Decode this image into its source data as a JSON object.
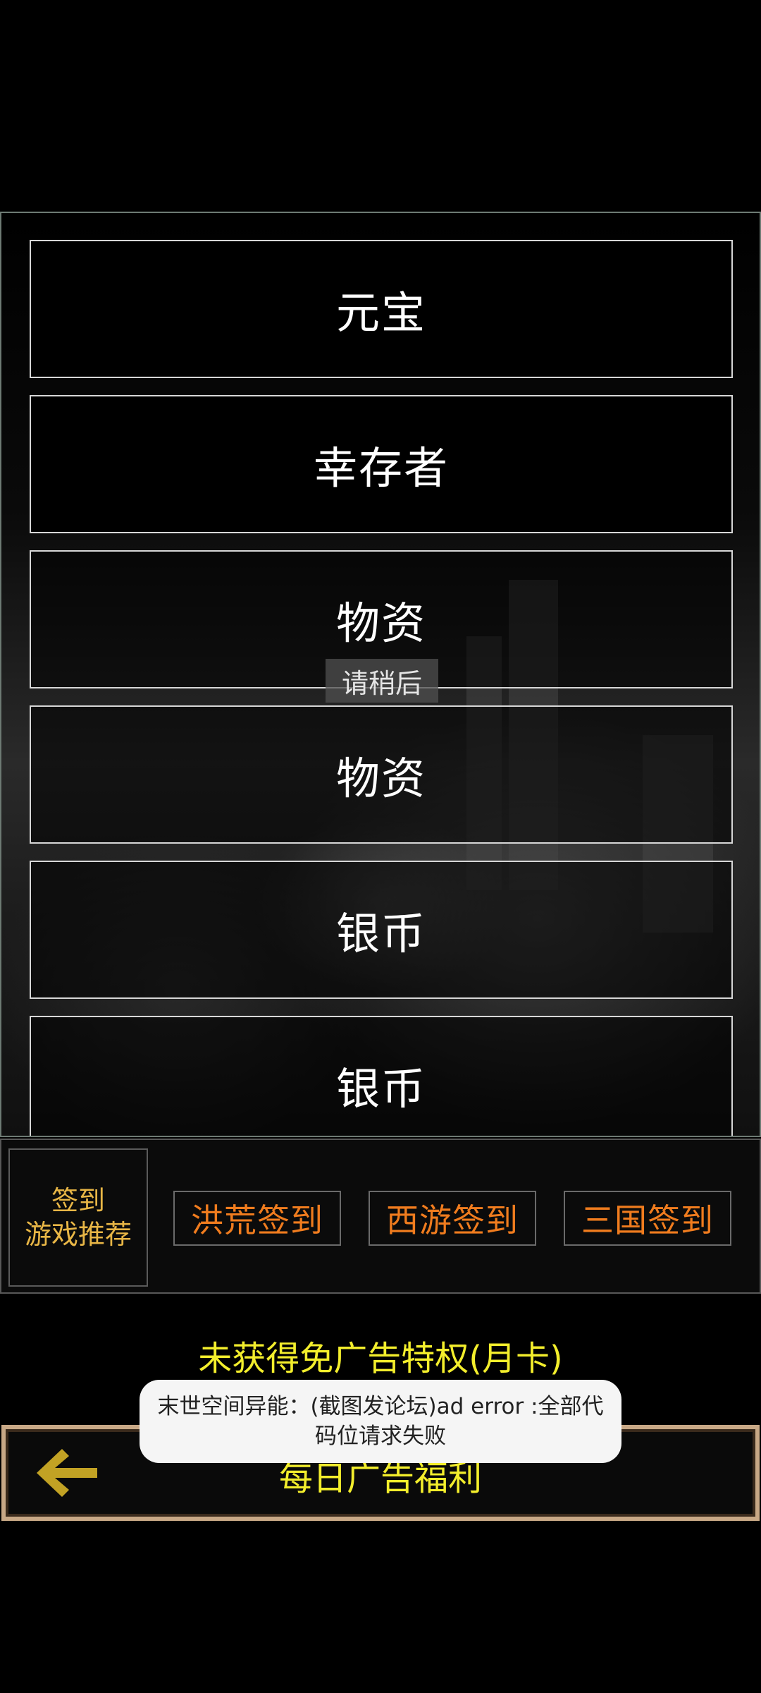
{
  "reward_list": {
    "items": [
      {
        "label": "元宝"
      },
      {
        "label": "幸存者"
      },
      {
        "label": "物资"
      },
      {
        "label": "物资"
      },
      {
        "label": "银币"
      },
      {
        "label": "银币"
      }
    ],
    "loading_text": "请稍后"
  },
  "signin_bar": {
    "main_line1": "签到",
    "main_line2": "游戏推荐",
    "tabs": [
      {
        "label": "洪荒签到"
      },
      {
        "label": "西游签到"
      },
      {
        "label": "三国签到"
      }
    ]
  },
  "footer": {
    "month_card_status": "未获得免广告特权(月卡)",
    "welfare_title": "每日广告福利",
    "back_icon": "left-arrow-icon"
  },
  "toast": {
    "message": "末世空间异能：(截图发论坛)ad error :全部代码位请求失败"
  },
  "colors": {
    "signin_main_text": "#e8b646",
    "signin_tab_text": "#f07c1e",
    "footer_text": "#f3ee2c",
    "welfare_border": "#c8a886"
  }
}
